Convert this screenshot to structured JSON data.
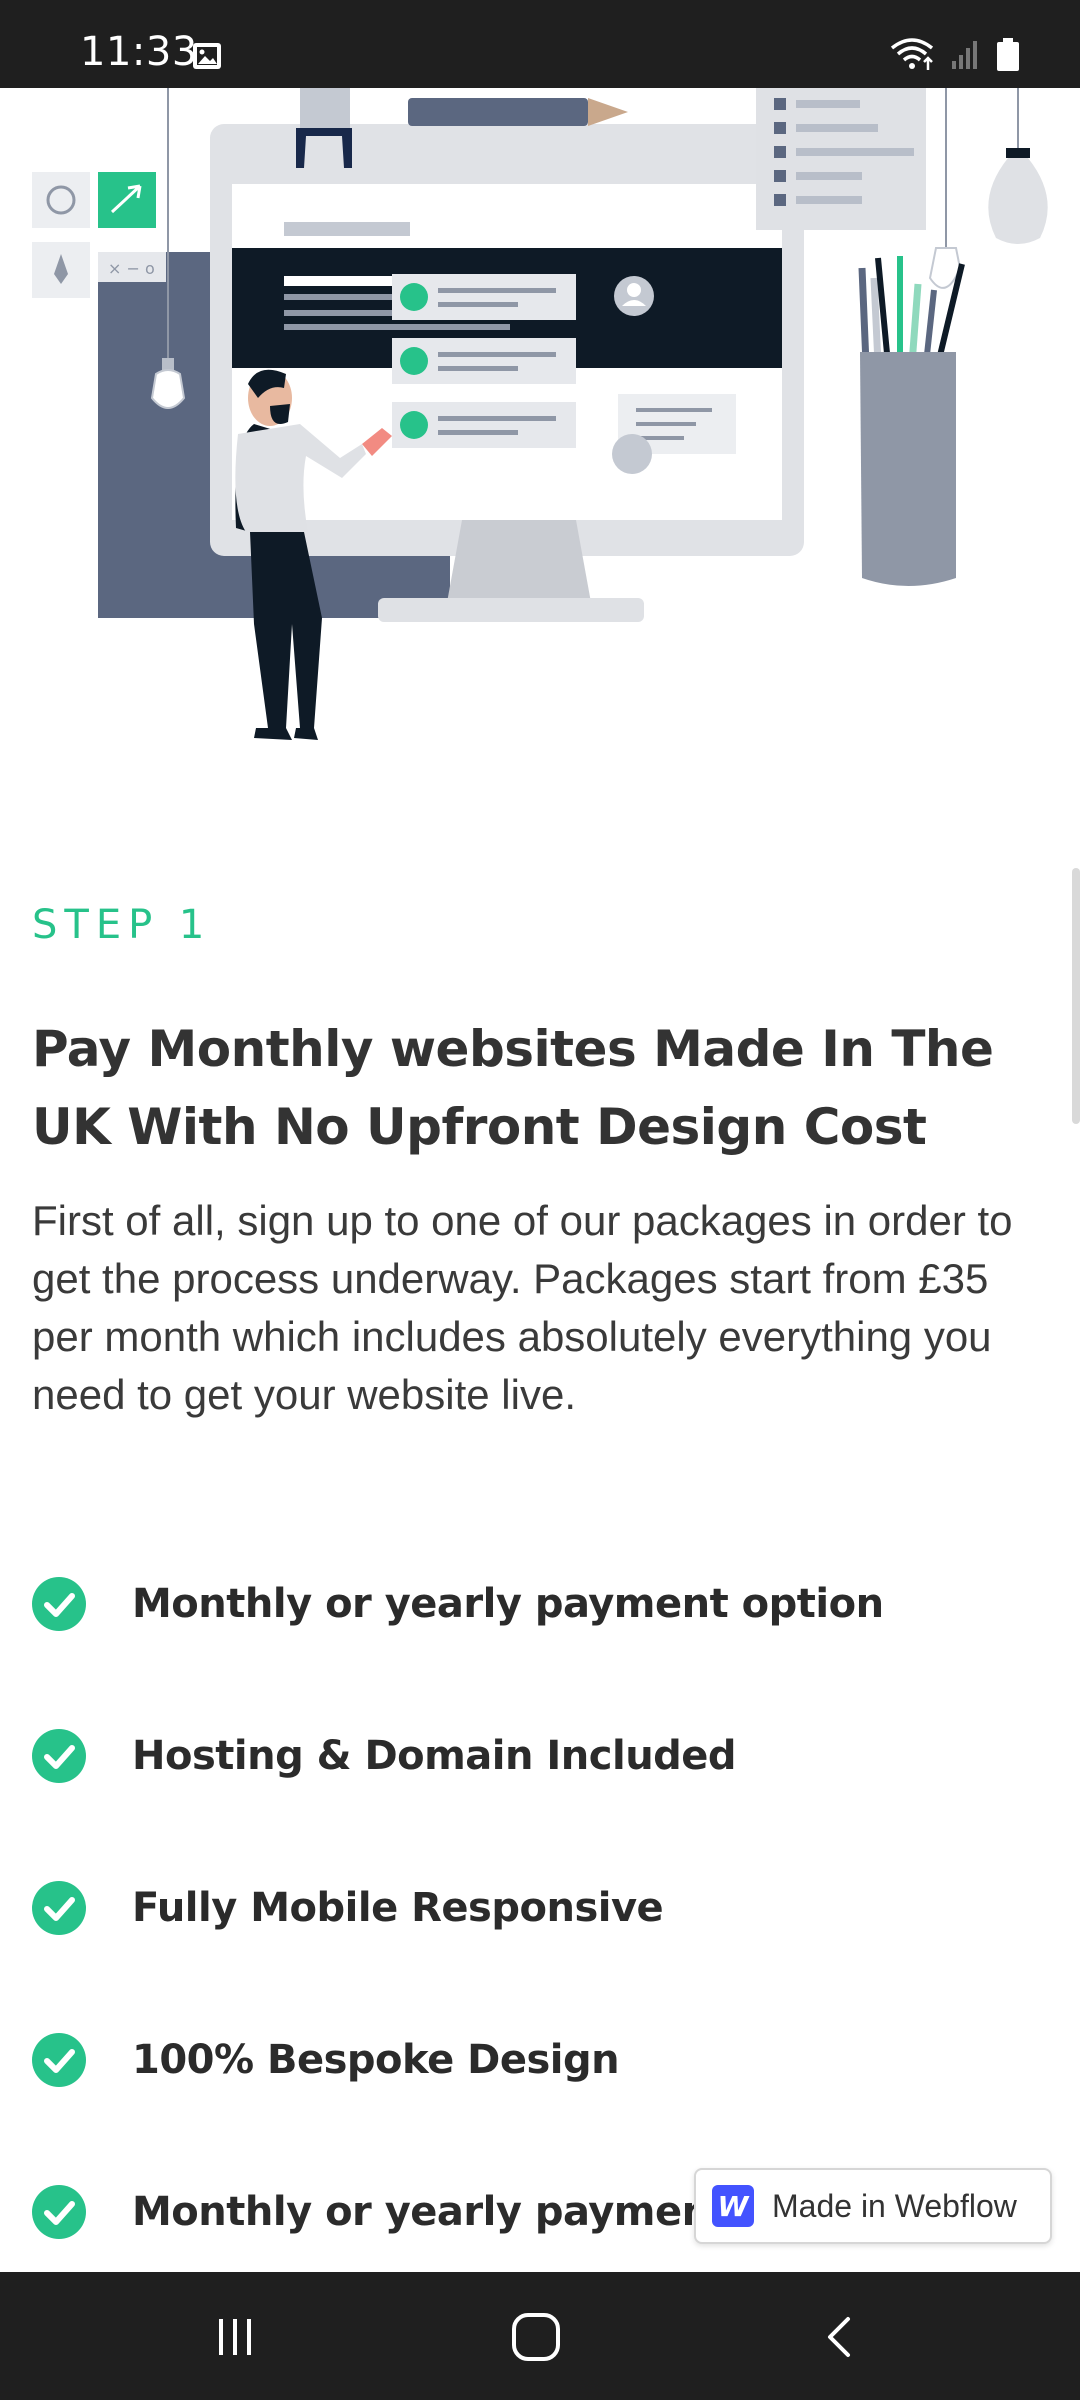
{
  "status_bar": {
    "time": "11:33",
    "icons": [
      "gallery-icon",
      "wifi-icon",
      "signal-icon",
      "battery-icon"
    ]
  },
  "hero": {
    "illustration": "web-design-illustration"
  },
  "section": {
    "step_label": "STEP 1",
    "heading": "Pay Monthly websites Made In The UK With No Upfront Design Cost",
    "body": "First of all, sign up to one of our packages in order to get the process underway. Packages start from £35 per month which includes absolutely everything you need to get your website live."
  },
  "features": [
    {
      "label": "Monthly or yearly payment option"
    },
    {
      "label": "Hosting & Domain Included"
    },
    {
      "label": "Fully Mobile Responsive"
    },
    {
      "label": "100% Bespoke Design"
    },
    {
      "label": "Monthly or yearly payment option"
    }
  ],
  "webflow_badge": {
    "label": "Made in Webflow",
    "logo_letter": "W"
  },
  "nav_bar": {
    "buttons": [
      "recent-apps",
      "home",
      "back"
    ]
  },
  "colors": {
    "accent": "#27c28a",
    "text": "#333333",
    "system_bar": "#1f1f1f",
    "webflow": "#4353ff"
  }
}
